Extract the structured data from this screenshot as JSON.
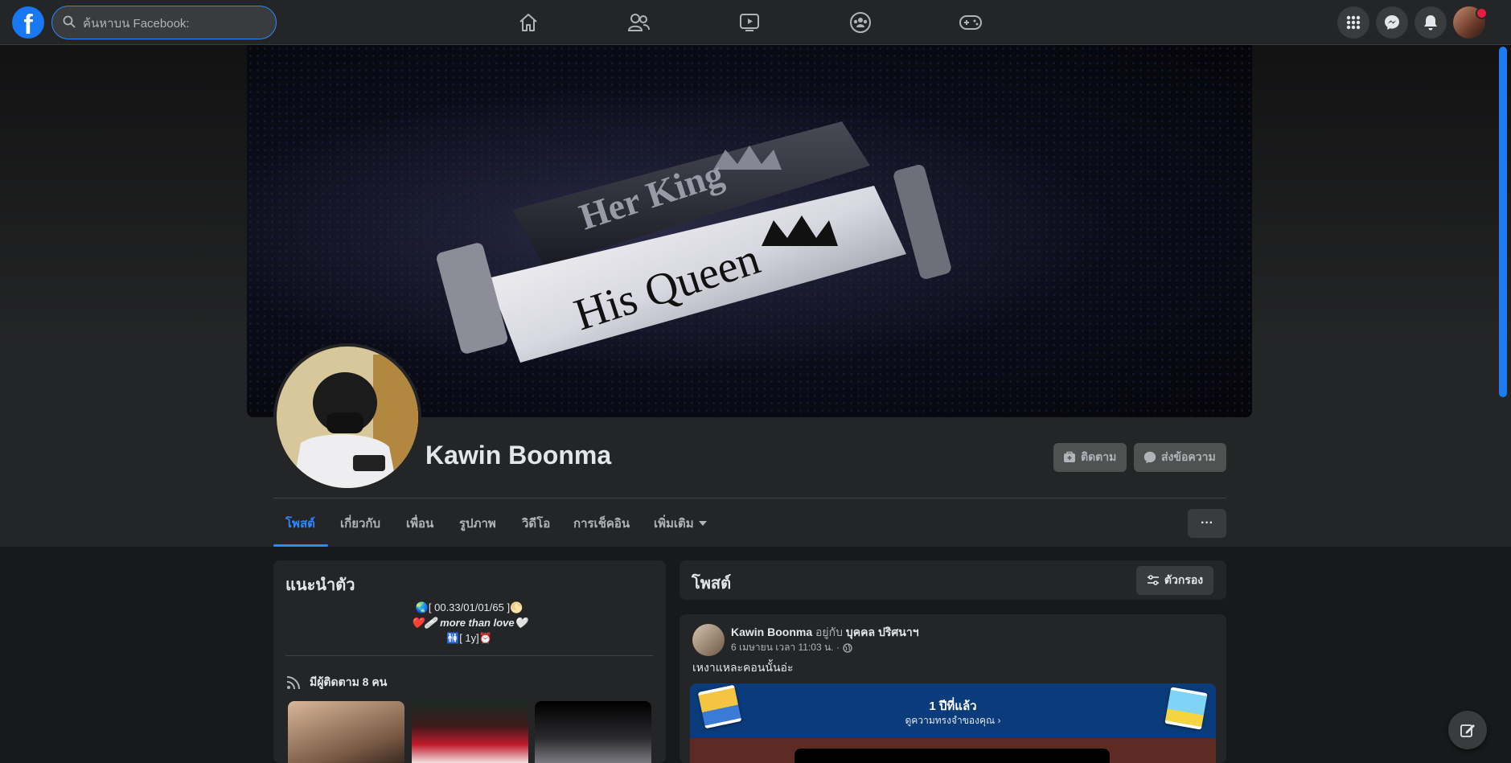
{
  "search": {
    "placeholder": "ค้นหาบน Facebook:"
  },
  "nav": {
    "items": [
      {
        "icon": "home-icon"
      },
      {
        "icon": "friends-icon"
      },
      {
        "icon": "watch-icon"
      },
      {
        "icon": "groups-icon"
      },
      {
        "icon": "gaming-icon"
      }
    ],
    "right": [
      "menu-grid-icon",
      "messenger-icon",
      "notifications-icon",
      "account-avatar"
    ]
  },
  "cover": {
    "line1": "Her King",
    "line2": "His Queen"
  },
  "profile": {
    "name": "Kawin Boonma",
    "follow_label": "ติดตาม",
    "message_label": "ส่งข้อความ"
  },
  "tabs": [
    {
      "label": "โพสต์",
      "active": true
    },
    {
      "label": "เกี่ยวกับ"
    },
    {
      "label": "เพื่อน"
    },
    {
      "label": "รูปภาพ"
    },
    {
      "label": "วิดีโอ"
    },
    {
      "label": "การเช็คอิน"
    },
    {
      "label": "เพิ่มเติม"
    }
  ],
  "more_button": "···",
  "intro": {
    "title": "แนะนำตัว",
    "bio": [
      "🌏[ 00.33/01/01/65 ]🌕",
      "❤️🩹 more than love🤍",
      "🚻[ 1y]⏰"
    ],
    "followers": "มีผู้ติดตาม 8 คน"
  },
  "posts": {
    "title": "โพสต์",
    "filter_label": "ตัวกรอง",
    "post": {
      "author": "Kawin Boonma",
      "with_text": " อยู่กับ ",
      "tagged": "บุคคล ปริศนาฯ",
      "meta": "6 เมษายน เวลา 11:03 น. ·",
      "text": "เหงาแหละคอนนั้นอ่ะ"
    },
    "memory": {
      "title": "1 ปีที่แล้ว",
      "link": "ดูความทรงจำของคุณ ›"
    }
  },
  "colors": {
    "accent": "#2d88ff",
    "background": "#18191a",
    "surface": "#242526"
  }
}
